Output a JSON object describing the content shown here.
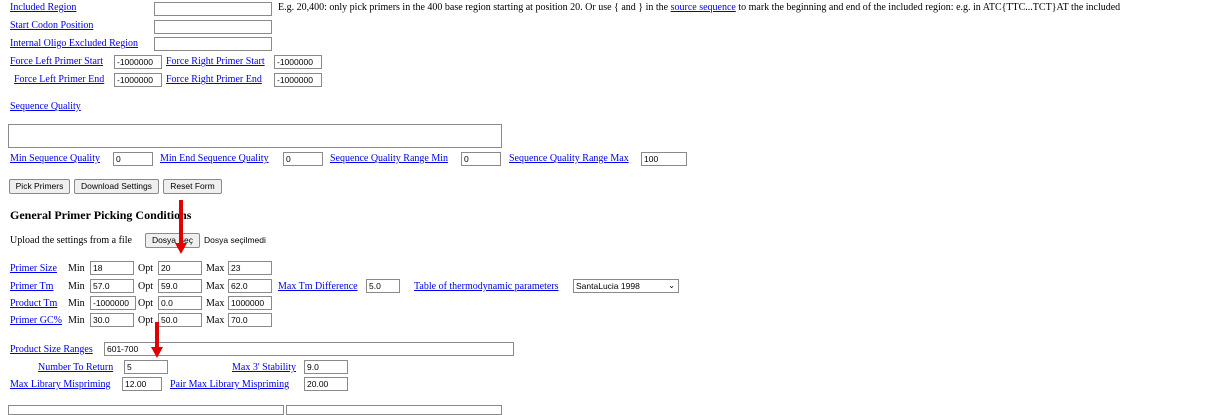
{
  "included_region": {
    "label": "Included Region",
    "value": "",
    "hint_prefix": "E.g. 20,400: only pick primers in the 400 base region starting at position 20. Or use { and } in the",
    "hint_link": "source sequence",
    "hint_suffix": "to mark the beginning and end of the included region: e.g. in ATC{TTC...TCT}AT the included"
  },
  "start_codon": {
    "label": "Start Codon Position",
    "value": ""
  },
  "internal_oligo_excluded": {
    "label": "Internal Oligo Excluded Region",
    "value": ""
  },
  "force": {
    "left_start_label": "Force Left Primer Start",
    "left_start_value": "-1000000",
    "right_start_label": "Force Right Primer Start",
    "right_start_value": "-1000000",
    "left_end_label": "Force Left Primer End",
    "left_end_value": "-1000000",
    "right_end_label": "Force Right Primer End",
    "right_end_value": "-1000000"
  },
  "sequence_quality": {
    "label": "Sequence Quality",
    "value": ""
  },
  "quality_params": {
    "min_label": "Min Sequence Quality",
    "min_value": "0",
    "min_end_label": "Min End Sequence Quality",
    "min_end_value": "0",
    "range_min_label": "Sequence Quality Range Min",
    "range_min_value": "0",
    "range_max_label": "Sequence Quality Range Max",
    "range_max_value": "100"
  },
  "buttons": {
    "pick": "Pick Primers",
    "download": "Download Settings",
    "reset": "Reset Form"
  },
  "general_heading": "General Primer Picking Conditions",
  "upload": {
    "label": "Upload the settings from a file",
    "button": "Dosya Seç",
    "status": "Dosya seçilmedi"
  },
  "words": {
    "min": "Min",
    "opt": "Opt",
    "max": "Max"
  },
  "primer_size": {
    "label": "Primer Size",
    "min": "18",
    "opt": "20",
    "max": "23"
  },
  "primer_tm": {
    "label": "Primer Tm",
    "min": "57.0",
    "opt": "59.0",
    "max": "62.0",
    "diff_label": "Max Tm Difference",
    "diff_value": "5.0",
    "table_label": "Table of thermodynamic parameters",
    "table_value": "SantaLucia 1998"
  },
  "product_tm": {
    "label": "Product Tm",
    "min": "-1000000",
    "opt": "0.0",
    "max": "1000000"
  },
  "primer_gc": {
    "label": "Primer GC%",
    "min": "30.0",
    "opt": "50.0",
    "max": "70.0"
  },
  "product_size_ranges": {
    "label": "Product Size Ranges",
    "value": "601-700"
  },
  "number_to_return": {
    "label": "Number To Return",
    "value": "5"
  },
  "max_3_stability": {
    "label": "Max 3' Stability",
    "value": "9.0"
  },
  "max_library_mispriming": {
    "label": "Max Library Mispriming",
    "value": "12.00"
  },
  "pair_max_library_mispriming": {
    "label": "Pair Max Library Mispriming",
    "value": "20.00"
  },
  "colors": {
    "link": "#0000ee",
    "arrow": "#e00000"
  }
}
